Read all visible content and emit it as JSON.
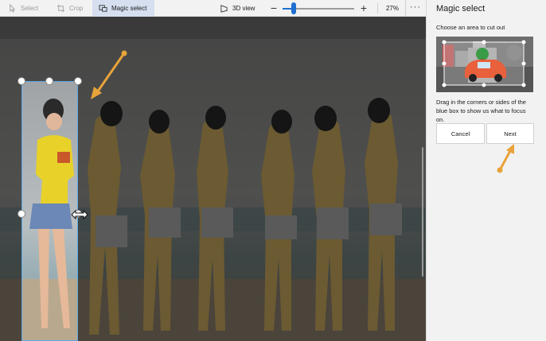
{
  "toolbar": {
    "select_label": "Select",
    "crop_label": "Crop",
    "magic_select_label": "Magic select",
    "view_3d_label": "3D view",
    "zoom_minus": "−",
    "zoom_plus": "+",
    "zoom_level": "27%",
    "zoom_fraction": 0.18,
    "more": "···"
  },
  "panel": {
    "title": "Magic select",
    "instruction": "Choose an area to cut out",
    "help_text": "Drag in the corners or sides of the blue box to show us what to focus on.",
    "cancel_label": "Cancel",
    "next_label": "Next"
  },
  "colors": {
    "accent": "#1e6fd0",
    "arrow": "#e8a33a",
    "tshirt": "#e8d22a",
    "selection_border": "#5ea8e6"
  },
  "icons": [
    "select-icon",
    "crop-icon",
    "magic-select-icon",
    "3d-view-icon",
    "more-icon"
  ]
}
